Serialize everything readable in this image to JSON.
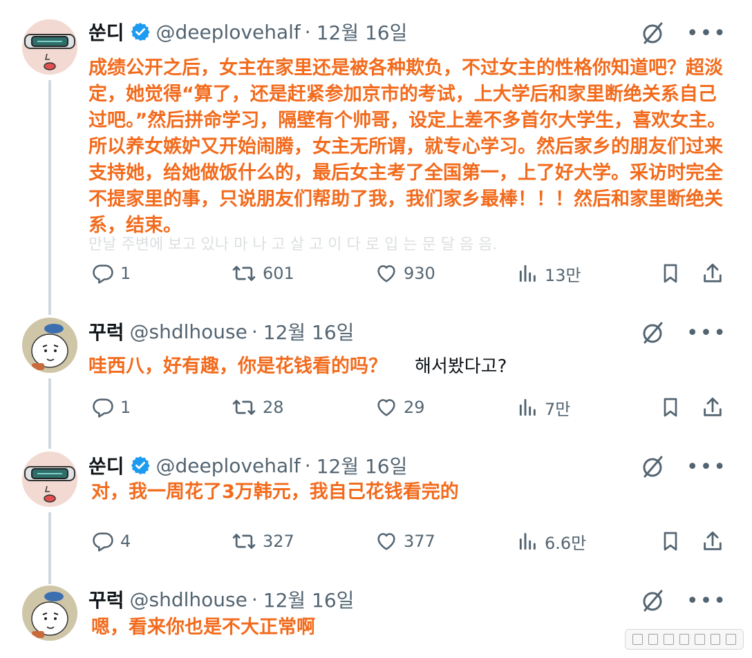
{
  "tweets": [
    {
      "name": "쑨디",
      "handle": "@deeplovehalf",
      "sep": "·",
      "date": "12월 16일",
      "verified": true,
      "text": "成绩公开之后，女主在家里还是被各种欺负，不过女主的性格你知道吧？超淡定，她觉得“算了，还是赶紧参加京市的考试，上大学后和家里断绝关系自己过吧。”然后拼命学习，隔壁有个帅哥，设定上差不多首尔大学生，喜欢女主。所以养女嫉妒又开始闹腾，女主无所谓，就专心学习。然后家乡的朋友们过来支持她，给她做饭什么的，最后女主考了全国第一，上了好大学。采访时完全不提家里的事，只说朋友们帮助了我，我们家乡最棒！！！然后和家里断绝关系，结束。",
      "ghost_line": "만날 주변에 보고 있나 마 나 고 살 고 이 다 로 입 는 문 달 음 음.",
      "replies": "1",
      "retweets": "601",
      "likes": "930",
      "views": "13만"
    },
    {
      "name": "꾸럭",
      "handle": "@shdlhouse",
      "sep": "·",
      "date": "12월 16일",
      "verified": false,
      "text": "哇西八，好有趣，你是花钱看的吗？",
      "ghost_text": "해서봤다고?",
      "replies": "1",
      "retweets": "28",
      "likes": "29",
      "views": "7만"
    },
    {
      "name": "쑨디",
      "handle": "@deeplovehalf",
      "sep": "·",
      "date": "12월 16일",
      "verified": true,
      "text": "对，我一周花了3万韩元，我自己花钱看完的",
      "replies": "4",
      "retweets": "327",
      "likes": "377",
      "views": "6.6만"
    },
    {
      "name": "꾸럭",
      "handle": "@shdlhouse",
      "sep": "·",
      "date": "12월 16일",
      "verified": false,
      "text": "嗯，看来你也是不大正常啊"
    }
  ],
  "icons": {
    "reply": "speech-bubble-icon",
    "retweet": "retweet-icon",
    "like": "heart-icon",
    "views": "bar-chart-icon",
    "bookmark": "bookmark-icon",
    "share": "share-icon",
    "grok": "slashed-circle-icon",
    "more": "more-dots-icon"
  },
  "colors": {
    "overlay_text": "#f26b1d",
    "verified": "#1d9bf0",
    "muted": "#536471",
    "thread_line": "#cfd9de"
  }
}
